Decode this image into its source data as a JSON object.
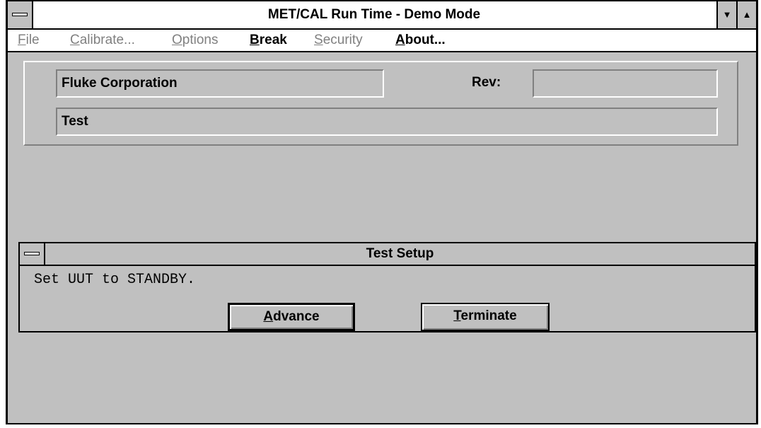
{
  "window": {
    "title": "MET/CAL Run Time - Demo Mode",
    "minimize_glyph": "▼",
    "maximize_glyph": "▲"
  },
  "menu": {
    "items": [
      {
        "accel": "F",
        "rest": "ile",
        "enabled": false
      },
      {
        "accel": "C",
        "rest": "alibrate...",
        "enabled": false
      },
      {
        "accel": "O",
        "rest": "ptions",
        "enabled": false
      },
      {
        "accel": "B",
        "rest": "reak",
        "enabled": true
      },
      {
        "accel": "S",
        "rest": "ecurity",
        "enabled": false
      },
      {
        "accel": "A",
        "rest": "bout...",
        "enabled": true
      }
    ]
  },
  "info": {
    "company": "Fluke Corporation",
    "rev_label": "Rev:",
    "rev_value": "",
    "procedure": "Test"
  },
  "dialog": {
    "title": "Test Setup",
    "message": "Set UUT to STANDBY.",
    "advance": {
      "accel": "A",
      "rest": "dvance"
    },
    "terminate": {
      "accel": "T",
      "rest": "erminate"
    }
  }
}
